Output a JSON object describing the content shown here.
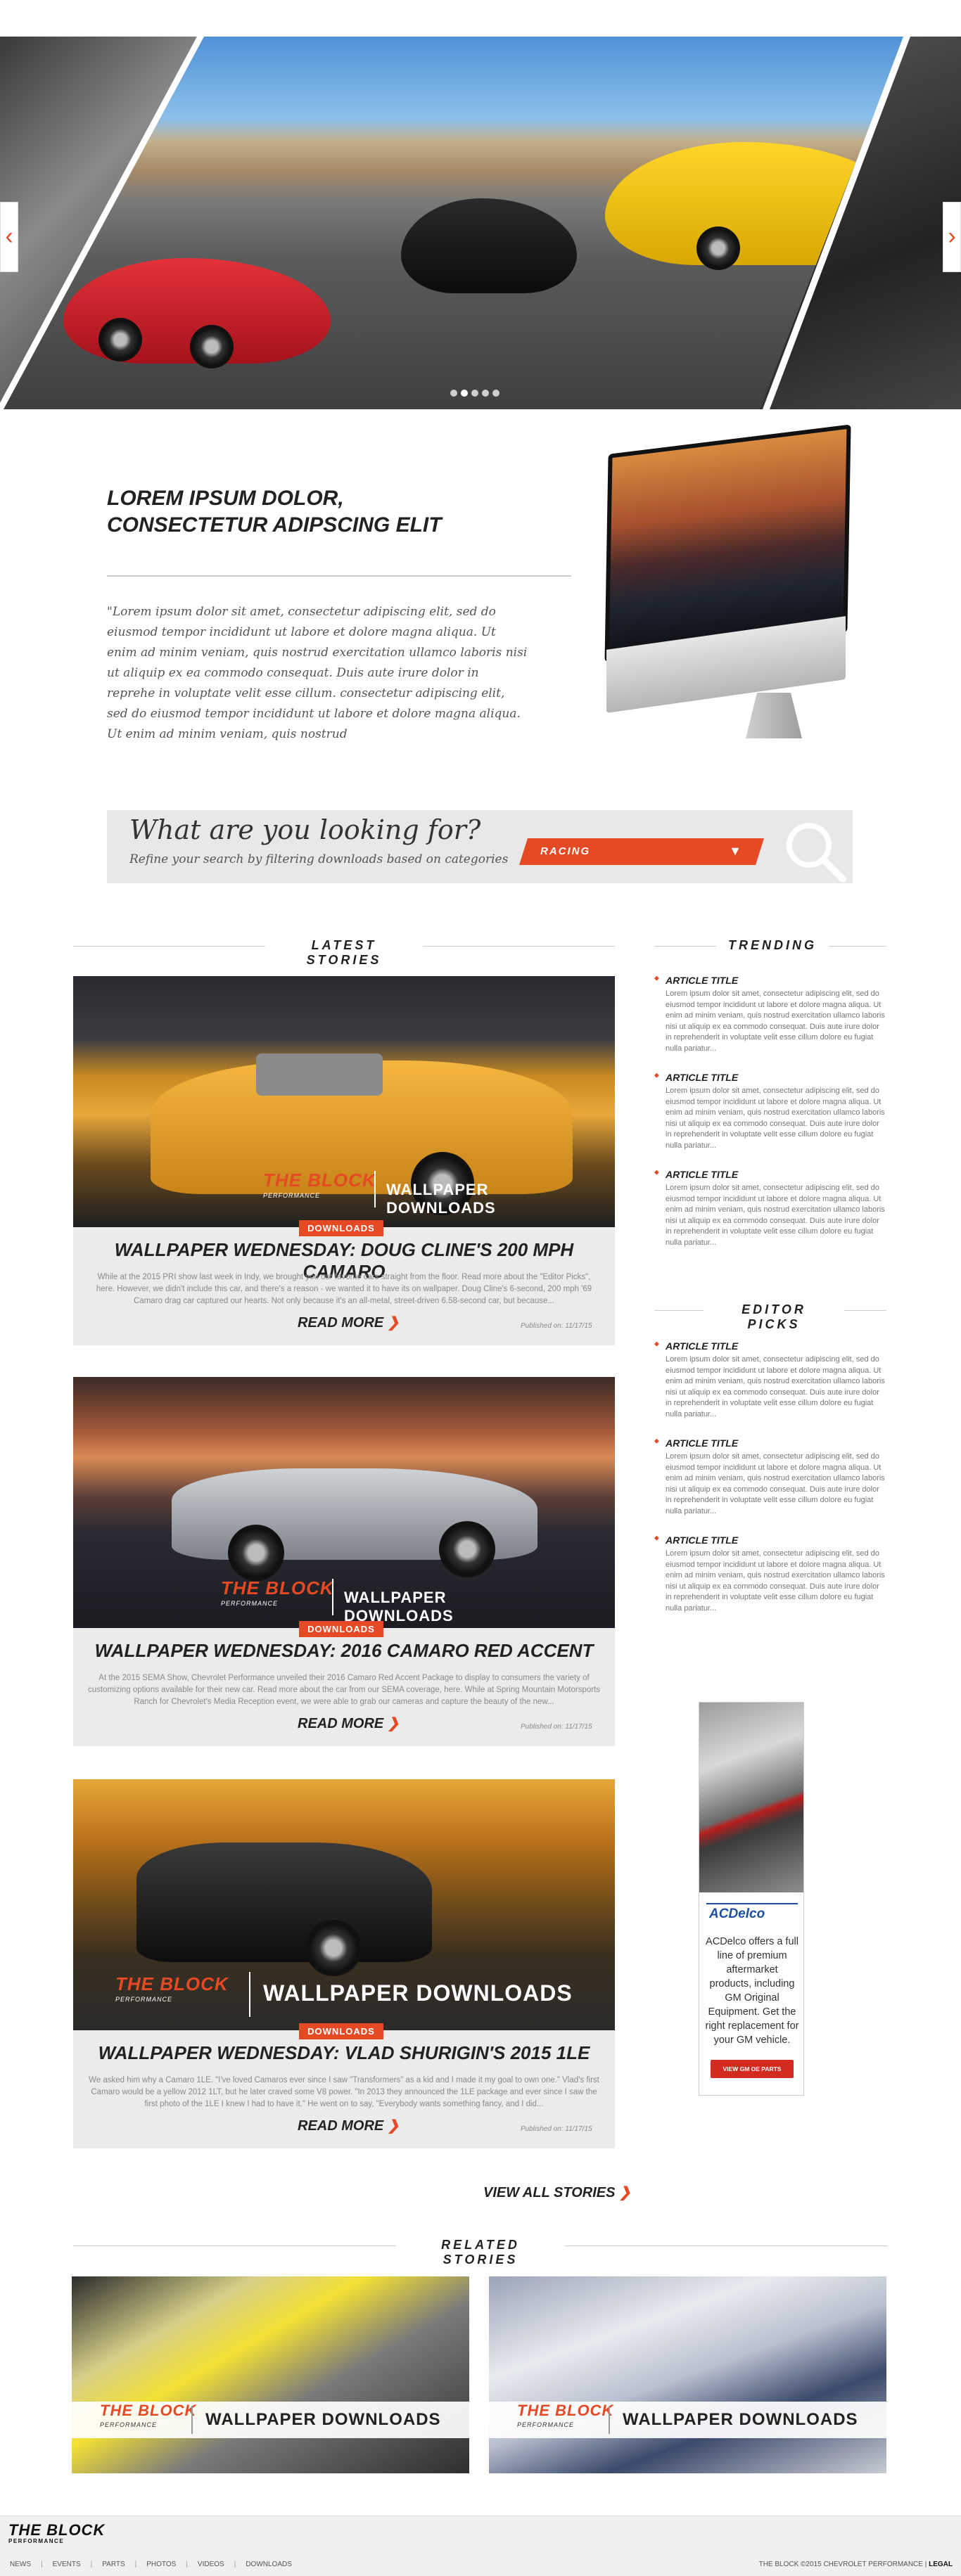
{
  "hero": {
    "dots": 5,
    "active_dot": 2,
    "prev_label": "‹",
    "next_label": "›"
  },
  "intro": {
    "title_line1": "LOREM IPSUM DOLOR,",
    "title_line2": "CONSECTETUR ADIPSCING ELIT",
    "quote": "\"Lorem ipsum dolor sit amet, consectetur adipiscing elit, sed do eiusmod tempor incididunt ut labore et dolore magna aliqua. Ut enim ad minim veniam, quis nostrud exercitation ullamco laboris nisi ut aliquip ex ea commodo consequat. Duis aute irure dolor in reprehe in voluptate velit esse cillum. consectetur adipiscing elit, sed do eiusmod tempor incididunt ut labore et dolore magna aliqua. Ut enim ad minim veniam, quis nostrud"
  },
  "search": {
    "title": "What are you looking for?",
    "subtitle": "Refine your search by filtering downloads based on categories",
    "selected": "RACING"
  },
  "sections": {
    "latest": "LATEST STORIES",
    "trending": "TRENDING",
    "editor": "EDITOR PICKS",
    "related": "RELATED STORIES"
  },
  "stories": [
    {
      "badge": "DOWNLOADS",
      "title": "WALLPAPER WEDNESDAY: DOUG CLINE'S 200 MPH CAMARO",
      "excerpt": "While at the 2015 PRI show last week in Indy, we brought you our favorite cars straight from the floor. Read more about the \"Editor Picks\", here. However, we didn't include this car, and there's a reason - we wanted it to have its on wallpaper. Doug Cline's 6-second, 200 mph '69 Camaro drag car captured our hearts.  Not only because it's an all-metal, street-driven 6.58-second car, but because...",
      "read_more": "READ MORE",
      "published": "Published on: 11/17/15",
      "overlay": "WALLPAPER DOWNLOADS"
    },
    {
      "badge": "DOWNLOADS",
      "title": "WALLPAPER WEDNESDAY: 2016 CAMARO RED ACCENT",
      "excerpt": "At the 2015 SEMA Show, Chevrolet Performance unveiled their 2016 Camaro Red Accent Package to display to consumers the variety of customizing options available for their new car. Read more about the car from our SEMA coverage, here. While at Spring Mountain Motorsports Ranch for Chevrolet's Media Reception event, we were able to grab our cameras and capture the beauty of the new...",
      "read_more": "READ MORE",
      "published": "Published on: 11/17/15",
      "overlay": "WALLPAPER DOWNLOADS"
    },
    {
      "badge": "DOWNLOADS",
      "title": "WALLPAPER WEDNESDAY: VLAD SHURIGIN'S 2015 1LE",
      "excerpt": "We asked him why a Camaro 1LE. \"I've loved Camaros ever since I saw \"Transformers\" as a kid and I made it my goal to own one.\" Vlad's first Camaro would be a yellow 2012 1LT, but he later craved some V8 power. \"In 2013 they announced the 1LE package and ever since I saw the first photo of the 1LE I knew I had to have it.\" He went on to say, \"Everybody wants something fancy, and I did...",
      "read_more": "READ MORE",
      "published": "Published on: 11/17/15",
      "overlay": "WALLPAPER DOWNLOADS"
    }
  ],
  "logo": {
    "text": "THE BLOCK",
    "sub": "PERFORMANCE",
    "url": "WWW.THEBLOCK.COM"
  },
  "trending": [
    {
      "title": "ARTICLE TITLE",
      "body": "Lorem ipsum dolor sit amet, consectetur adipiscing elit, sed do eiusmod tempor incididunt ut labore et dolore magna aliqua. Ut enim ad minim veniam, quis nostrud exercitation ullamco laboris nisi ut aliquip ex ea commodo consequat. Duis aute irure dolor in reprehenderit in voluptate velit esse cillum dolore eu fugiat nulla pariatur..."
    },
    {
      "title": "ARTICLE TITLE",
      "body": "Lorem ipsum dolor sit amet, consectetur adipiscing elit, sed do eiusmod tempor incididunt ut labore et dolore magna aliqua. Ut enim ad minim veniam, quis nostrud exercitation ullamco laboris nisi ut aliquip ex ea commodo consequat. Duis aute irure dolor in reprehenderit in voluptate velit esse cillum dolore eu fugiat nulla pariatur..."
    },
    {
      "title": "ARTICLE TITLE",
      "body": "Lorem ipsum dolor sit amet, consectetur adipiscing elit, sed do eiusmod tempor incididunt ut labore et dolore magna aliqua. Ut enim ad minim veniam, quis nostrud exercitation ullamco laboris nisi ut aliquip ex ea commodo consequat. Duis aute irure dolor in reprehenderit in voluptate velit esse cillum dolore eu fugiat nulla pariatur..."
    }
  ],
  "editor_picks": [
    {
      "title": "ARTICLE TITLE",
      "body": "Lorem ipsum dolor sit amet, consectetur adipiscing elit, sed do eiusmod tempor incididunt ut labore et dolore magna aliqua. Ut enim ad minim veniam, quis nostrud exercitation ullamco laboris nisi ut aliquip ex ea commodo consequat. Duis aute irure dolor in reprehenderit in voluptate velit esse cillum dolore eu fugiat nulla pariatur..."
    },
    {
      "title": "ARTICLE TITLE",
      "body": "Lorem ipsum dolor sit amet, consectetur adipiscing elit, sed do eiusmod tempor incididunt ut labore et dolore magna aliqua. Ut enim ad minim veniam, quis nostrud exercitation ullamco laboris nisi ut aliquip ex ea commodo consequat. Duis aute irure dolor in reprehenderit in voluptate velit esse cillum dolore eu fugiat nulla pariatur..."
    },
    {
      "title": "ARTICLE TITLE",
      "body": "Lorem ipsum dolor sit amet, consectetur adipiscing elit, sed do eiusmod tempor incididunt ut labore et dolore magna aliqua. Ut enim ad minim veniam, quis nostrud exercitation ullamco laboris nisi ut aliquip ex ea commodo consequat. Duis aute irure dolor in reprehenderit in voluptate velit esse cillum dolore eu fugiat nulla pariatur..."
    }
  ],
  "ad": {
    "brand": "ACDelco",
    "text": "ACDelco offers a full line of premium aftermarket products, including GM Original Equipment. Get the right replacement for your GM vehicle.",
    "button": "VIEW GM OE PARTS"
  },
  "view_all": "VIEW ALL STORIES",
  "related": [
    {
      "overlay": "WALLPAPER DOWNLOADS"
    },
    {
      "overlay": "WALLPAPER DOWNLOADS"
    }
  ],
  "footer": {
    "logo": "THE BLOCK",
    "logo_sub": "PERFORMANCE",
    "nav": [
      "NEWS",
      "EVENTS",
      "PARTS",
      "PHOTOS",
      "VIDEOS",
      "DOWNLOADS"
    ],
    "copyright": "THE BLOCK ©2015 CHEVROLET PERFORMANCE",
    "legal": "LEGAL"
  },
  "colors": {
    "accent": "#e54a24",
    "card": "#ebebeb",
    "text": "#222222"
  }
}
